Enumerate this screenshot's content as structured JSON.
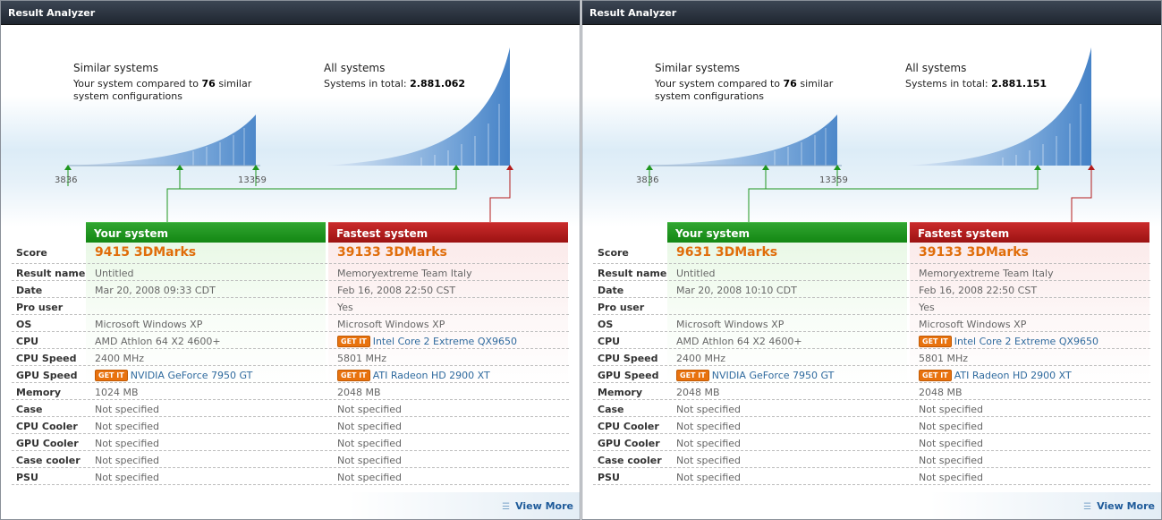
{
  "panels": [
    {
      "title": "Result Analyzer",
      "similar": {
        "heading": "Similar systems",
        "text_a": "Your system compared to ",
        "count": "76",
        "text_b": " similar",
        "text_c": "system configurations",
        "range_min": "3836",
        "range_max": "13359"
      },
      "all": {
        "heading": "All systems",
        "text": "Systems in total: ",
        "total": "2.881.062"
      },
      "your_system_label": "Your system",
      "fastest_system_label": "Fastest system",
      "rows": [
        {
          "label": "Score",
          "yours": "9415 3DMarks",
          "fastest": "39133 3DMarks"
        },
        {
          "label": "Result name",
          "yours": "Untitled",
          "fastest": "Memoryextreme Team Italy"
        },
        {
          "label": "Date",
          "yours": "Mar 20, 2008 09:33 CDT",
          "fastest": "Feb 16, 2008 22:50 CST"
        },
        {
          "label": "Pro user",
          "yours": "",
          "fastest": "Yes"
        },
        {
          "label": "OS",
          "yours": "Microsoft Windows XP",
          "fastest": "Microsoft Windows XP"
        },
        {
          "label": "CPU",
          "yours": "AMD Athlon 64 X2 4600+",
          "fastest": "Intel Core 2 Extreme QX9650"
        },
        {
          "label": "CPU Speed",
          "yours": "2400 MHz",
          "fastest": "5801 MHz"
        },
        {
          "label": "GPU Speed",
          "yours": "NVIDIA GeForce 7950 GT",
          "fastest": "ATI Radeon HD 2900 XT"
        },
        {
          "label": "Memory",
          "yours": "1024 MB",
          "fastest": "2048 MB"
        },
        {
          "label": "Case",
          "yours": "Not specified",
          "fastest": "Not specified"
        },
        {
          "label": "CPU Cooler",
          "yours": "Not specified",
          "fastest": "Not specified"
        },
        {
          "label": "GPU Cooler",
          "yours": "Not specified",
          "fastest": "Not specified"
        },
        {
          "label": "Case cooler",
          "yours": "Not specified",
          "fastest": "Not specified"
        },
        {
          "label": "PSU",
          "yours": "Not specified",
          "fastest": "Not specified"
        }
      ],
      "get_it_label": "GET IT",
      "view_more_label": "View More"
    },
    {
      "title": "Result Analyzer",
      "similar": {
        "heading": "Similar systems",
        "text_a": "Your system compared to ",
        "count": "76",
        "text_b": " similar",
        "text_c": "system configurations",
        "range_min": "3836",
        "range_max": "13359"
      },
      "all": {
        "heading": "All systems",
        "text": "Systems in total: ",
        "total": "2.881.151"
      },
      "your_system_label": "Your system",
      "fastest_system_label": "Fastest system",
      "rows": [
        {
          "label": "Score",
          "yours": "9631 3DMarks",
          "fastest": "39133 3DMarks"
        },
        {
          "label": "Result name",
          "yours": "Untitled",
          "fastest": "Memoryextreme Team Italy"
        },
        {
          "label": "Date",
          "yours": "Mar 20, 2008 10:10 CDT",
          "fastest": "Feb 16, 2008 22:50 CST"
        },
        {
          "label": "Pro user",
          "yours": "",
          "fastest": "Yes"
        },
        {
          "label": "OS",
          "yours": "Microsoft Windows XP",
          "fastest": "Microsoft Windows XP"
        },
        {
          "label": "CPU",
          "yours": "AMD Athlon 64 X2 4600+",
          "fastest": "Intel Core 2 Extreme QX9650"
        },
        {
          "label": "CPU Speed",
          "yours": "2400 MHz",
          "fastest": "5801 MHz"
        },
        {
          "label": "GPU Speed",
          "yours": "NVIDIA GeForce 7950 GT",
          "fastest": "ATI Radeon HD 2900 XT"
        },
        {
          "label": "Memory",
          "yours": "2048 MB",
          "fastest": "2048 MB"
        },
        {
          "label": "Case",
          "yours": "Not specified",
          "fastest": "Not specified"
        },
        {
          "label": "CPU Cooler",
          "yours": "Not specified",
          "fastest": "Not specified"
        },
        {
          "label": "GPU Cooler",
          "yours": "Not specified",
          "fastest": "Not specified"
        },
        {
          "label": "Case cooler",
          "yours": "Not specified",
          "fastest": "Not specified"
        },
        {
          "label": "PSU",
          "yours": "Not specified",
          "fastest": "Not specified"
        }
      ],
      "get_it_label": "GET IT",
      "view_more_label": "View More"
    }
  ],
  "colors": {
    "your_system": "#1f961f",
    "fastest_system": "#b41c1c",
    "score_text": "#e06d0a",
    "link": "#2f6a9e",
    "get_it": "#e8720e",
    "curve": "#4a86c8"
  }
}
